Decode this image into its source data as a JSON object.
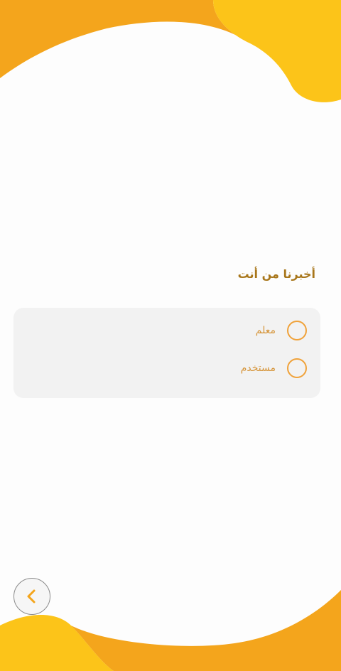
{
  "question": {
    "text": "أخبرنا من أنت"
  },
  "options": [
    {
      "label": "معلم",
      "selected": false
    },
    {
      "label": "مستخدم",
      "selected": false
    }
  ],
  "nav": {
    "back_icon": "chevron-left-icon"
  },
  "colors": {
    "accent_orange": "#f4a51c",
    "accent_yellow": "#fcc419",
    "radio_border": "#f0a23a",
    "label_text": "#d6953a",
    "question_text": "#a8761a",
    "card_bg": "#f2f2f2"
  }
}
